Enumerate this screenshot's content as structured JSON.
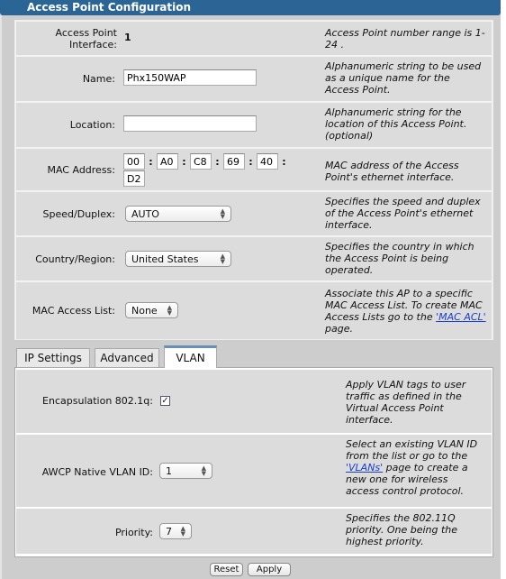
{
  "header": {
    "title": "Access Point Configuration"
  },
  "fields": {
    "ap_interface": {
      "label": "Access Point Interface:",
      "value": "1",
      "desc": "Access Point number range is 1-24 ."
    },
    "name": {
      "label": "Name:",
      "value": "Phx150WAP",
      "desc": "Alphanumeric string to be used as a unique name for the Access Point."
    },
    "location": {
      "label": "Location:",
      "value": "",
      "desc": "Alphanumeric string for the location of this Access Point. (optional)"
    },
    "mac": {
      "label": "MAC Address:",
      "octets": [
        "00",
        "A0",
        "C8",
        "69",
        "40",
        "D2"
      ],
      "separator": ":",
      "desc": "MAC address of the Access Point's ethernet interface."
    },
    "speed": {
      "label": "Speed/Duplex:",
      "value": "AUTO",
      "desc": "Specifies the speed and duplex of the Access Point's ethernet interface."
    },
    "country": {
      "label": "Country/Region:",
      "value": "United States",
      "desc": "Specifies the country in which the Access Point is being operated."
    },
    "mac_acl": {
      "label": "MAC Access List:",
      "value": "None",
      "desc_pre": "Associate this AP to a specific MAC Access List. To create MAC Access Lists go to the ",
      "link": "'MAC ACL'",
      "desc_post": " page."
    }
  },
  "tabs": [
    {
      "label": "IP Settings"
    },
    {
      "label": "Advanced"
    },
    {
      "label": "VLAN",
      "active": true
    }
  ],
  "vlan": {
    "encap": {
      "label": "Encapsulation 802.1q:",
      "checked": true,
      "desc": "Apply VLAN tags to user traffic as defined in the Virtual Access Point interface."
    },
    "native": {
      "label": "AWCP Native VLAN ID:",
      "value": "1",
      "desc_pre": "Select an existing VLAN ID from the list or go to the ",
      "link": "'VLANs'",
      "desc_post": " page to create a new one for wireless access control protocol."
    },
    "priority": {
      "label": "Priority:",
      "value": "7",
      "desc": "Specifies the 802.11Q priority. One being the highest priority."
    }
  },
  "buttons": {
    "reset": "Reset",
    "apply": "Apply"
  },
  "colors": {
    "header": "#2b6596",
    "link": "#1a3fcf"
  }
}
